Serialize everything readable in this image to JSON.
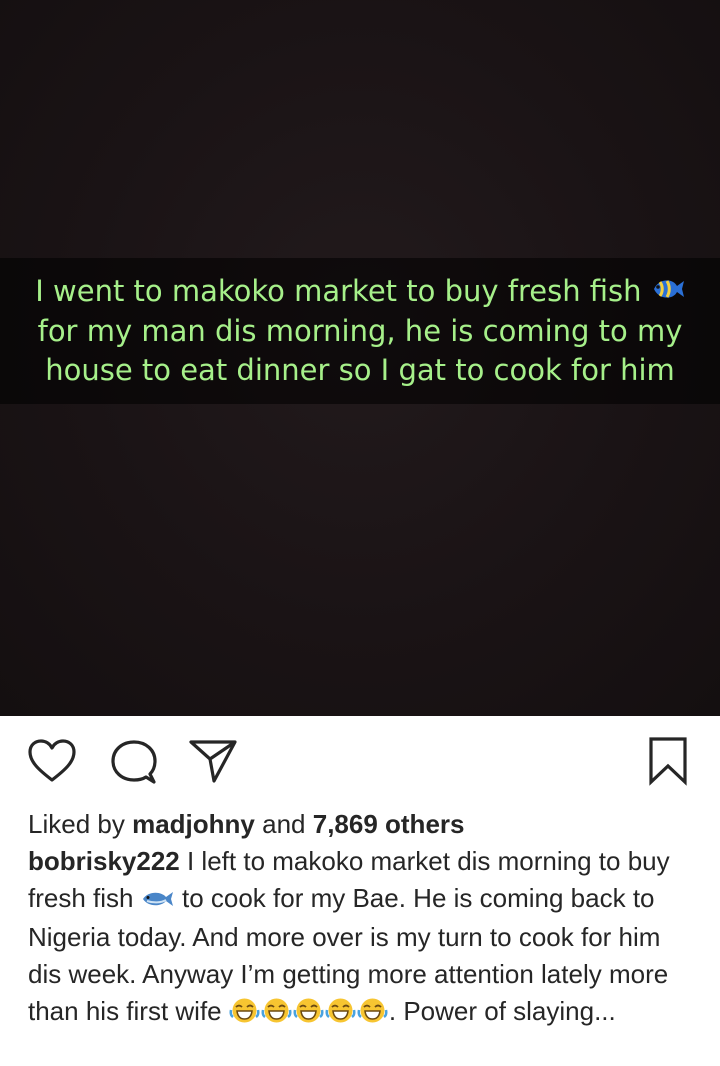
{
  "photo": {
    "overlay_text_line1": "I went to makoko market to buy fresh fish",
    "overlay_text_line2": "for my man dis morning, he is coming to my",
    "overlay_text_line3": "house to eat dinner so I gat to cook for him",
    "overlay_emoji": "tropical-fish-emoji"
  },
  "actions": {
    "like_icon": "heart-icon",
    "comment_icon": "comment-icon",
    "share_icon": "send-icon",
    "save_icon": "bookmark-icon"
  },
  "likes": {
    "prefix": "Liked by",
    "user": "madjohny",
    "middle": "and",
    "count": "7,869 others"
  },
  "caption": {
    "username": "bobrisky222",
    "text_part1": "I left to makoko market dis morning to buy fresh fish",
    "text_part2": "to cook for my Bae. He is coming back to Nigeria today. And more over is my turn to cook for him dis week. Anyway I’m getting more attention lately more than his first wife",
    "text_part3": ". Power of slaying...",
    "fish_emoji": "fish-emoji",
    "laugh_emoji": "face-with-tears-of-joy-emoji",
    "laugh_emoji_count": 5
  },
  "colors": {
    "overlay_text": "#a6f08a",
    "photo_bg": "#1a1315",
    "text": "#262626"
  }
}
